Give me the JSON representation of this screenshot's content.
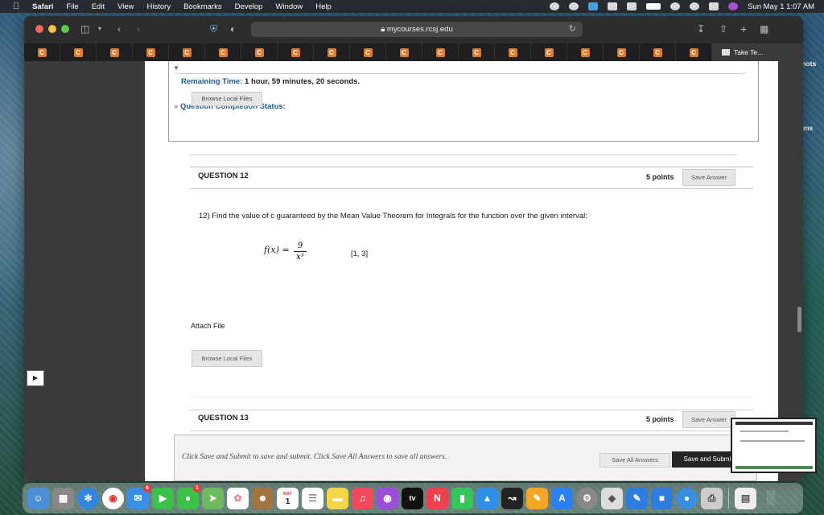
{
  "menubar": {
    "app_name": "Safari",
    "items": [
      "File",
      "Edit",
      "View",
      "History",
      "Bookmarks",
      "Develop",
      "Window",
      "Help"
    ],
    "clock": "Sun May 1  1:07 AM"
  },
  "browser": {
    "url": "mycourses.rcsj.edu",
    "tab_icon_letter": "C",
    "active_tab_title": "Take Te..."
  },
  "test": {
    "remaining_label": "Remaining Time:",
    "remaining_value": "1 hour, 59 minutes, 20 seconds.",
    "question_completion_label": "Question Completion Status:",
    "overlay_button": "Browse Local Files"
  },
  "questions": [
    {
      "heading": "QUESTION 12",
      "points": "5 points",
      "save_button": "Save Answer",
      "text": "12) Find the value of c guaranteed by the Mean Value Theorem for Integrals for the function over the given interval:",
      "formula_lhs": "f(x) =",
      "formula_num": "9",
      "formula_den": "x³",
      "interval": "[1, 3]",
      "attach_label": "Attach File",
      "browse_button": "Browse Local Files"
    },
    {
      "heading": "QUESTION 13",
      "points": "5 points",
      "save_button": "Save Answer"
    }
  ],
  "footer": {
    "instructions": "Click Save and Submit to save and submit. Click Save All Answers to save all answers.",
    "save_all": "Save All Answers",
    "save_submit": "Save and Submit"
  },
  "side_labels": {
    "shots": "n Shots",
    "items": "ted Items"
  },
  "dock": {
    "calendar_month": "MAY",
    "calendar_day": "1",
    "mail_badge": "6",
    "maps_badge": "1",
    "tv_label": "tv"
  }
}
